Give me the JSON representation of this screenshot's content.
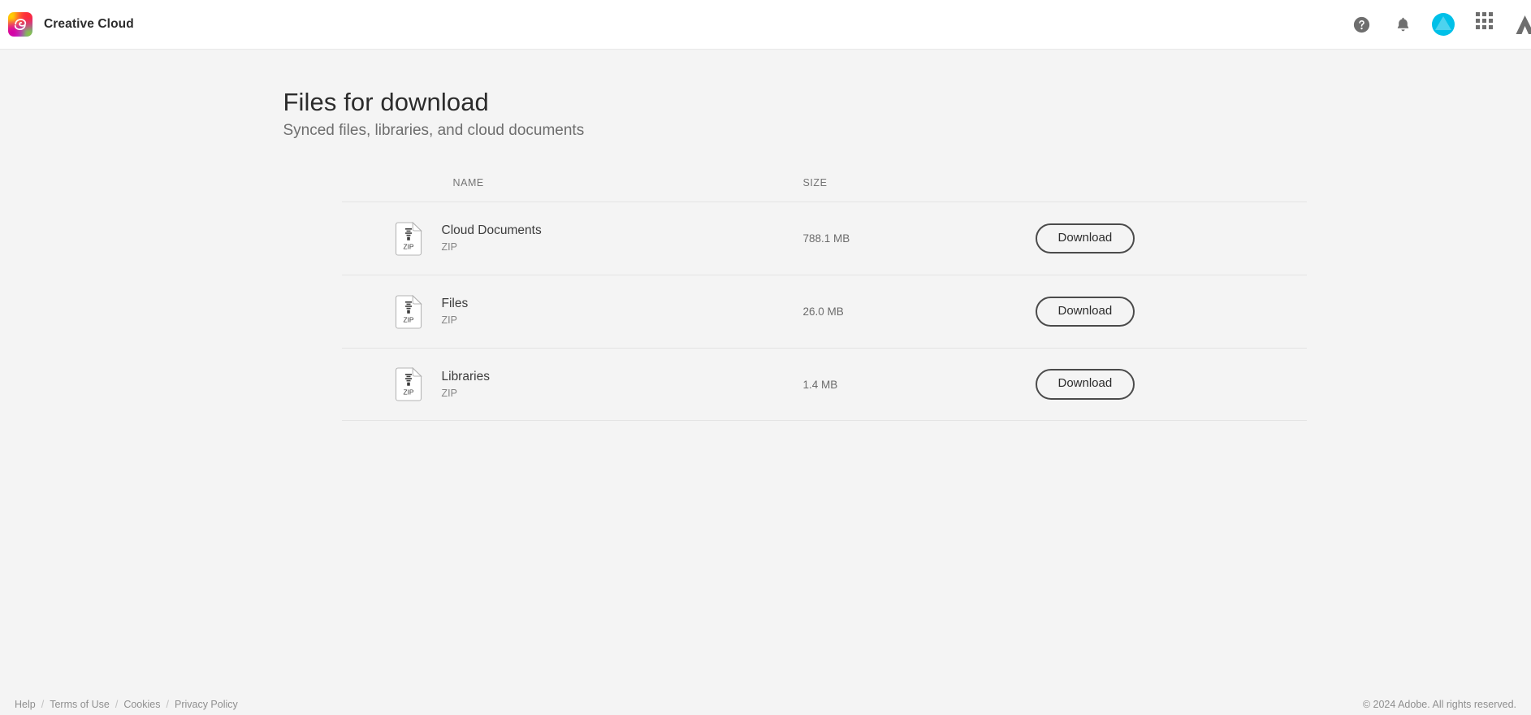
{
  "header": {
    "app_title": "Creative Cloud",
    "logo_icon": "creative-cloud-logo",
    "help_icon": "help-circle-icon",
    "notifications_icon": "bell-icon",
    "avatar_icon": "user-avatar",
    "apps_grid_icon": "app-grid-icon",
    "adobe_icon": "adobe-logo",
    "avatar_color": "#00c0e8"
  },
  "main": {
    "title": "Files for download",
    "subtitle": "Synced files, libraries, and cloud documents",
    "columns": {
      "name": "NAME",
      "size": "SIZE"
    },
    "rows": [
      {
        "name": "Cloud Documents",
        "type": "ZIP",
        "icon_label": "ZIP",
        "size": "788.1 MB",
        "action": "Download"
      },
      {
        "name": "Files",
        "type": "ZIP",
        "icon_label": "ZIP",
        "size": "26.0 MB",
        "action": "Download"
      },
      {
        "name": "Libraries",
        "type": "ZIP",
        "icon_label": "ZIP",
        "size": "1.4 MB",
        "action": "Download"
      }
    ]
  },
  "footer": {
    "links": [
      "Help",
      "Terms of Use",
      "Cookies",
      "Privacy Policy"
    ],
    "separator": "/",
    "copyright": "© 2024 Adobe. All rights reserved."
  }
}
